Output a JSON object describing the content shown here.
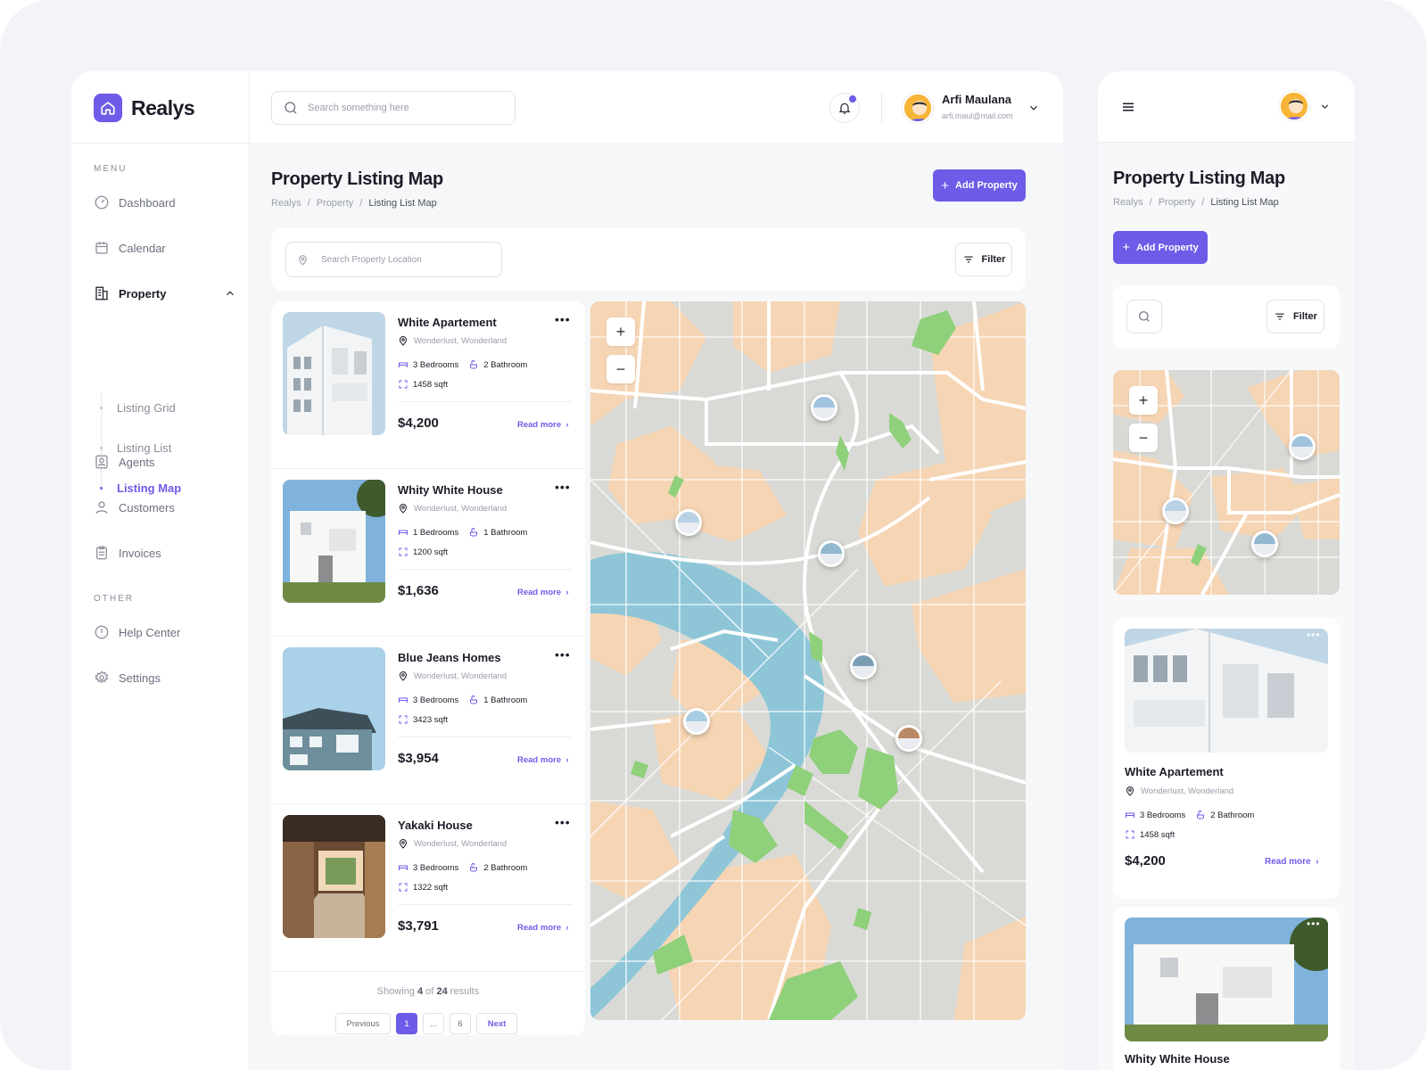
{
  "app": {
    "name": "Realys"
  },
  "search": {
    "placeholder": "Search something here"
  },
  "user": {
    "name": "Arfi Maulana",
    "email": "arfi.maul@mail.com"
  },
  "sidebar": {
    "menu_label": "MENU",
    "other_label": "OTHER",
    "items": [
      {
        "label": "Dashboard"
      },
      {
        "label": "Calendar"
      },
      {
        "label": "Property"
      },
      {
        "label": "Agents"
      },
      {
        "label": "Customers"
      },
      {
        "label": "Invoices"
      }
    ],
    "sub_items": [
      {
        "label": "Listing Grid"
      },
      {
        "label": "Listing List"
      },
      {
        "label": "Listing Map"
      }
    ],
    "other_items": [
      {
        "label": "Help Center"
      },
      {
        "label": "Settings"
      }
    ]
  },
  "page": {
    "title": "Property Listing Map",
    "breadcrumb": [
      "Realys",
      "/",
      "Property",
      "/",
      "Listing List Map"
    ],
    "add_button": "Add Property",
    "location_placeholder": "Search Property Location",
    "filter_label": "Filter"
  },
  "listings": [
    {
      "title": "White Apartement",
      "location": "Wonderlust, Wonderland",
      "bedrooms": "3 Bedrooms",
      "bathrooms": "2 Bathroom",
      "area": "1458 sqft",
      "price": "$4,200",
      "read_more": "Read more"
    },
    {
      "title": "Whity White House",
      "location": "Wonderlust, Wonderland",
      "bedrooms": "1 Bedrooms",
      "bathrooms": "1 Bathroom",
      "area": "1200 sqft",
      "price": "$1,636",
      "read_more": "Read more"
    },
    {
      "title": "Blue Jeans Homes",
      "location": "Wonderlust, Wonderland",
      "bedrooms": "3 Bedrooms",
      "bathrooms": "1 Bathroom",
      "area": "3423 sqft",
      "price": "$3,954",
      "read_more": "Read more"
    },
    {
      "title": "Yakaki House",
      "location": "Wonderlust, Wonderland",
      "bedrooms": "3 Bedrooms",
      "bathrooms": "2 Bathroom",
      "area": "1322 sqft",
      "price": "$3,791",
      "read_more": "Read more"
    }
  ],
  "pagination": {
    "showing_prefix": "Showing",
    "shown": "4",
    "of_text": "of",
    "total": "24",
    "suffix": "results",
    "previous": "Previous",
    "current": "1",
    "ellipsis": "...",
    "last": "6",
    "next": "Next"
  },
  "map": {
    "zoom_in": "+",
    "zoom_out": "−"
  },
  "mobile": {
    "title": "Property Listing Map",
    "breadcrumb": [
      "Realys",
      "/",
      "Property",
      "/",
      "Listing List Map"
    ],
    "add_button": "Add Property",
    "filter_label": "Filter",
    "cards": [
      {
        "title": "White Apartement",
        "location": "Wonderlust, Wonderland",
        "bedrooms": "3 Bedrooms",
        "bathrooms": "2 Bathroom",
        "area": "1458 sqft",
        "price": "$4,200",
        "read_more": "Read more"
      },
      {
        "title": "Whity White House"
      }
    ]
  },
  "colors": {
    "accent": "#6c5ce7",
    "map_land": "#d9dad6",
    "map_zone": "#f6d5b4",
    "map_river": "#8ec6d8",
    "map_park": "#8fd07a"
  }
}
